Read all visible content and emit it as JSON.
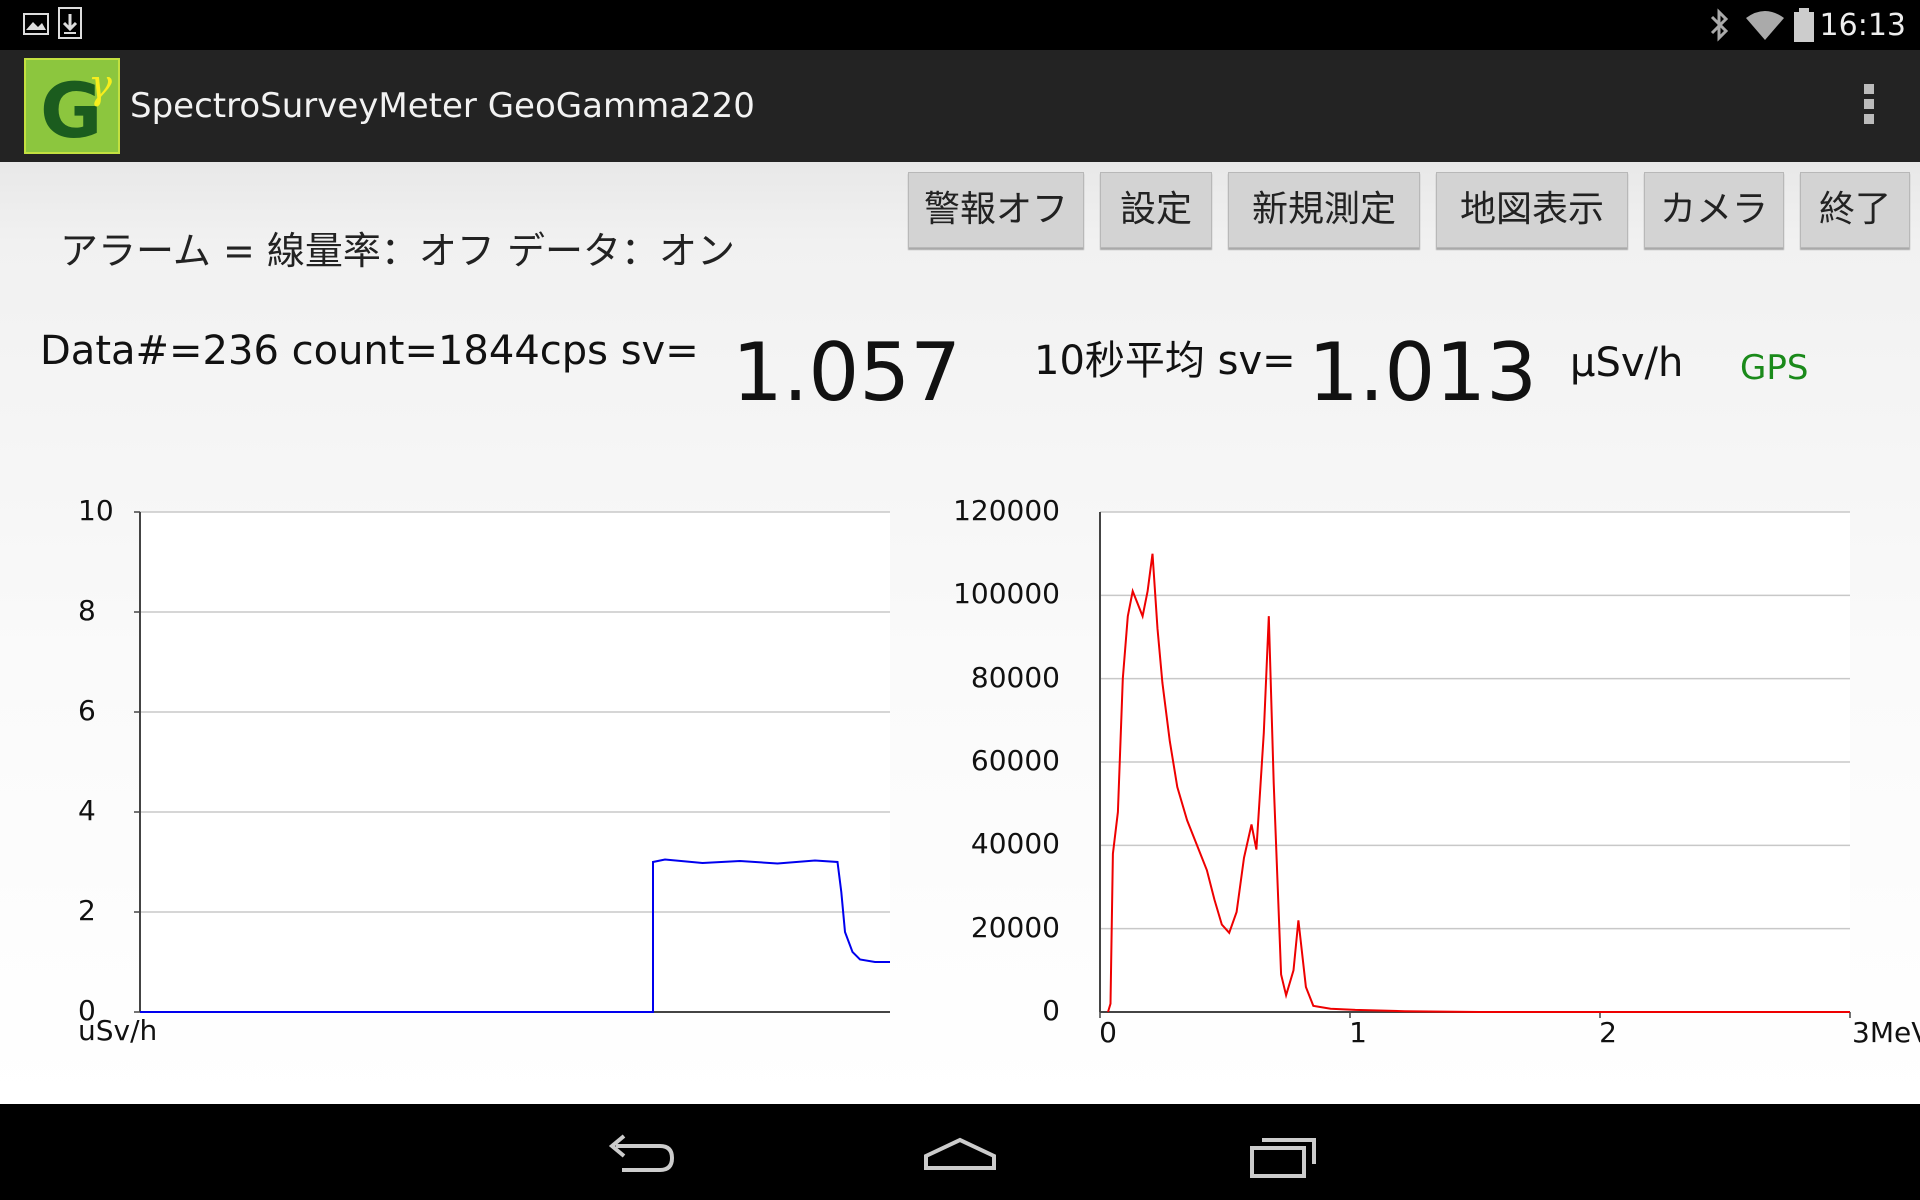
{
  "statusbar": {
    "time": "16:13",
    "left_icons": [
      "image-icon",
      "download-icon"
    ],
    "right_icons": [
      "bluetooth-icon",
      "wifi-icon",
      "battery-icon"
    ]
  },
  "app": {
    "title": "SpectroSurveyMeter GeoGamma220",
    "logo_letter": "G",
    "logo_mark": "γ"
  },
  "buttons": [
    {
      "id": "alarm-off",
      "label": "警報オフ"
    },
    {
      "id": "settings",
      "label": "設定"
    },
    {
      "id": "new-measure",
      "label": "新規測定"
    },
    {
      "id": "map-view",
      "label": "地図表示"
    },
    {
      "id": "camera",
      "label": "カメラ"
    },
    {
      "id": "exit",
      "label": "終了"
    }
  ],
  "status": {
    "alarm_text": "アラーム = 線量率：オフ  データ：オン"
  },
  "reading": {
    "data_label": "Data#=236  count=1844cps  sv=",
    "sv_value": "1.057",
    "avg_label": "10秒平均 sv=",
    "avg_value": "1.013",
    "unit": "μSv/h",
    "gps_label": "GPS"
  },
  "colors": {
    "dose_line": "#0000ee",
    "spectrum_line": "#ee0000",
    "gps": "#1a8a1a",
    "action_bar": "#232323"
  },
  "chart_data": [
    {
      "type": "line",
      "ylim": [
        0,
        10
      ],
      "yticks": [
        "0",
        "2",
        "4",
        "6",
        "8",
        "10"
      ],
      "ylabel": "uSv/h",
      "series": [
        {
          "x": [
            0,
            0.684,
            0.684,
            0.7,
            0.75,
            0.8,
            0.85,
            0.9,
            0.93,
            0.935,
            0.94,
            0.95,
            0.96,
            0.98,
            1.0
          ],
          "values": [
            0,
            0,
            3.0,
            3.05,
            2.98,
            3.02,
            2.97,
            3.03,
            3.0,
            2.4,
            1.6,
            1.2,
            1.05,
            1.0,
            1.0
          ]
        }
      ]
    },
    {
      "type": "line",
      "xlim": [
        0,
        3
      ],
      "ylim": [
        0,
        120000
      ],
      "xticks": [
        "0",
        "1",
        "2",
        "3MeV"
      ],
      "yticks": [
        "0",
        "20000",
        "40000",
        "60000",
        "80000",
        "100000",
        "120000"
      ],
      "series": [
        {
          "x": [
            0,
            0.01,
            0.02,
            0.04,
            0.06,
            0.08,
            0.1,
            0.12,
            0.14,
            0.16,
            0.18,
            0.2,
            0.22,
            0.25,
            0.28,
            0.32,
            0.36,
            0.4,
            0.43,
            0.46,
            0.49,
            0.52,
            0.55,
            0.58,
            0.6,
            0.63,
            0.65,
            0.67,
            0.7,
            0.72,
            0.75,
            0.77,
            0.8,
            0.83,
            0.9,
            1.0,
            1.2,
            1.5,
            2.0,
            3.0
          ],
          "values": [
            0,
            2000,
            38000,
            48000,
            80000,
            95000,
            101000,
            98000,
            95000,
            101000,
            110000,
            92000,
            79000,
            65000,
            54000,
            46000,
            40000,
            34000,
            27000,
            21000,
            19000,
            24000,
            37000,
            45000,
            39000,
            67000,
            95000,
            55000,
            9000,
            4000,
            10000,
            22000,
            6000,
            1500,
            800,
            500,
            200,
            0,
            0,
            0
          ]
        }
      ]
    }
  ]
}
